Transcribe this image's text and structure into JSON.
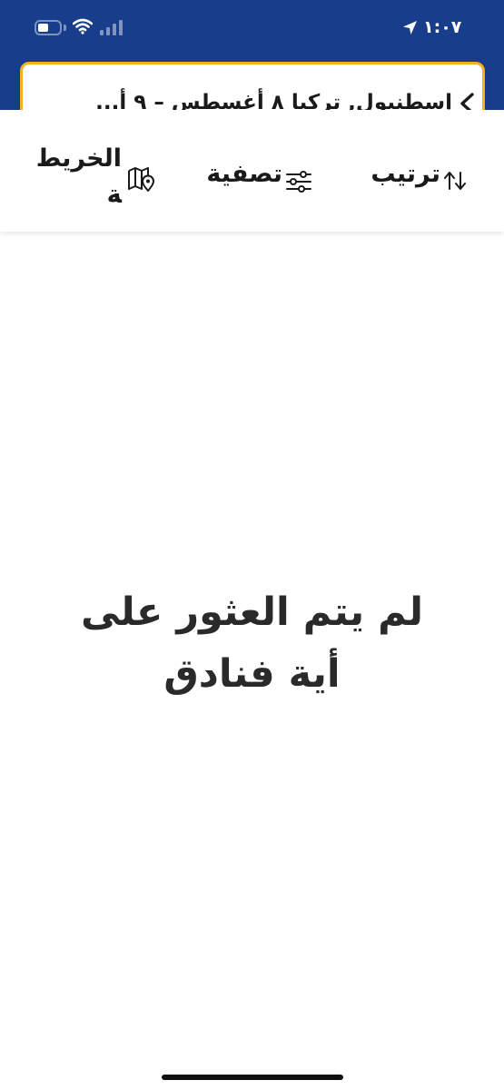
{
  "status_bar": {
    "time": "١:٠٧"
  },
  "search": {
    "summary": "إسطنبول, تركيا  ٨ أغسطس – ٩ أ..."
  },
  "toolbar": {
    "sort_label": "ترتيب",
    "filter_label": "تصفية",
    "map_label": "الخريطة"
  },
  "results": {
    "empty_message": "لم يتم العثور على أية فنادق"
  },
  "colors": {
    "header": "#183d8a",
    "search_border": "#f2b31a",
    "background": "#ffffff"
  }
}
